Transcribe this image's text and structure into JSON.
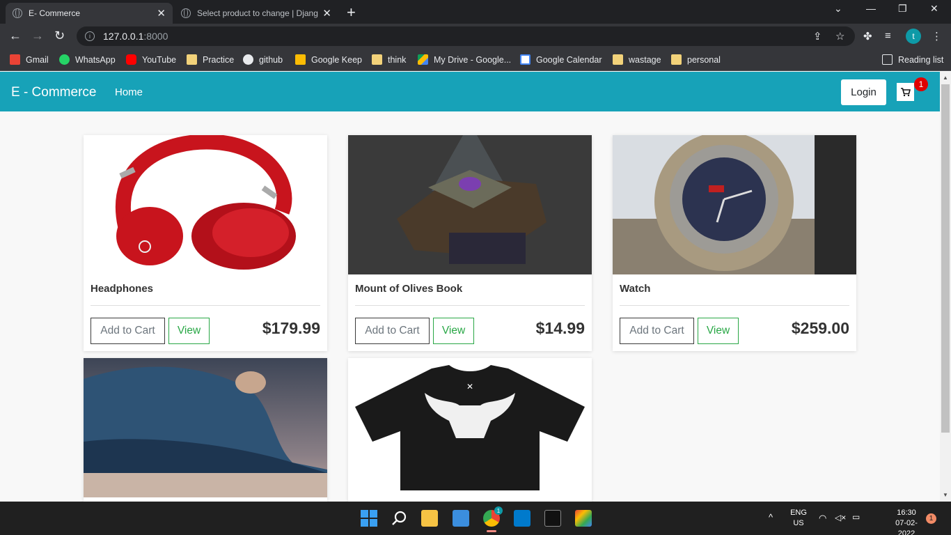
{
  "browser": {
    "tabs": [
      {
        "title": "E- Commerce",
        "active": true
      },
      {
        "title": "Select product to change | Djang",
        "active": false
      }
    ],
    "url_host": "127.0.0.1",
    "url_port": ":8000",
    "bookmarks": [
      {
        "label": "Gmail",
        "icon": "gmail-icon"
      },
      {
        "label": "WhatsApp",
        "icon": "whatsapp-icon"
      },
      {
        "label": "YouTube",
        "icon": "youtube-icon"
      },
      {
        "label": "Practice",
        "icon": "folder-icon"
      },
      {
        "label": "github",
        "icon": "github-icon"
      },
      {
        "label": "Google Keep",
        "icon": "keep-icon"
      },
      {
        "label": "think",
        "icon": "folder-icon"
      },
      {
        "label": "My Drive - Google...",
        "icon": "drive-icon"
      },
      {
        "label": "Google Calendar",
        "icon": "calendar-icon"
      },
      {
        "label": "wastage",
        "icon": "folder-icon"
      },
      {
        "label": "personal",
        "icon": "folder-icon"
      }
    ],
    "reading_list": "Reading list",
    "profile_initial": "t"
  },
  "site": {
    "brand": "E - Commerce",
    "nav_home": "Home",
    "login": "Login",
    "cart_count": "1"
  },
  "products": [
    {
      "name": "Headphones",
      "price": "$179.99",
      "add": "Add to Cart",
      "view": "View"
    },
    {
      "name": "Mount of Olives Book",
      "price": "$14.99",
      "add": "Add to Cart",
      "view": "View"
    },
    {
      "name": "Watch",
      "price": "$259.00",
      "add": "Add to Cart",
      "view": "View"
    },
    {
      "name": "",
      "price": "",
      "add": "",
      "view": ""
    },
    {
      "name": "",
      "price": "",
      "add": "",
      "view": ""
    }
  ],
  "taskbar": {
    "lang": "ENG",
    "region": "US",
    "time": "16:30",
    "date": "07-02-2022",
    "notifications": "1",
    "chrome_badge": "1"
  }
}
